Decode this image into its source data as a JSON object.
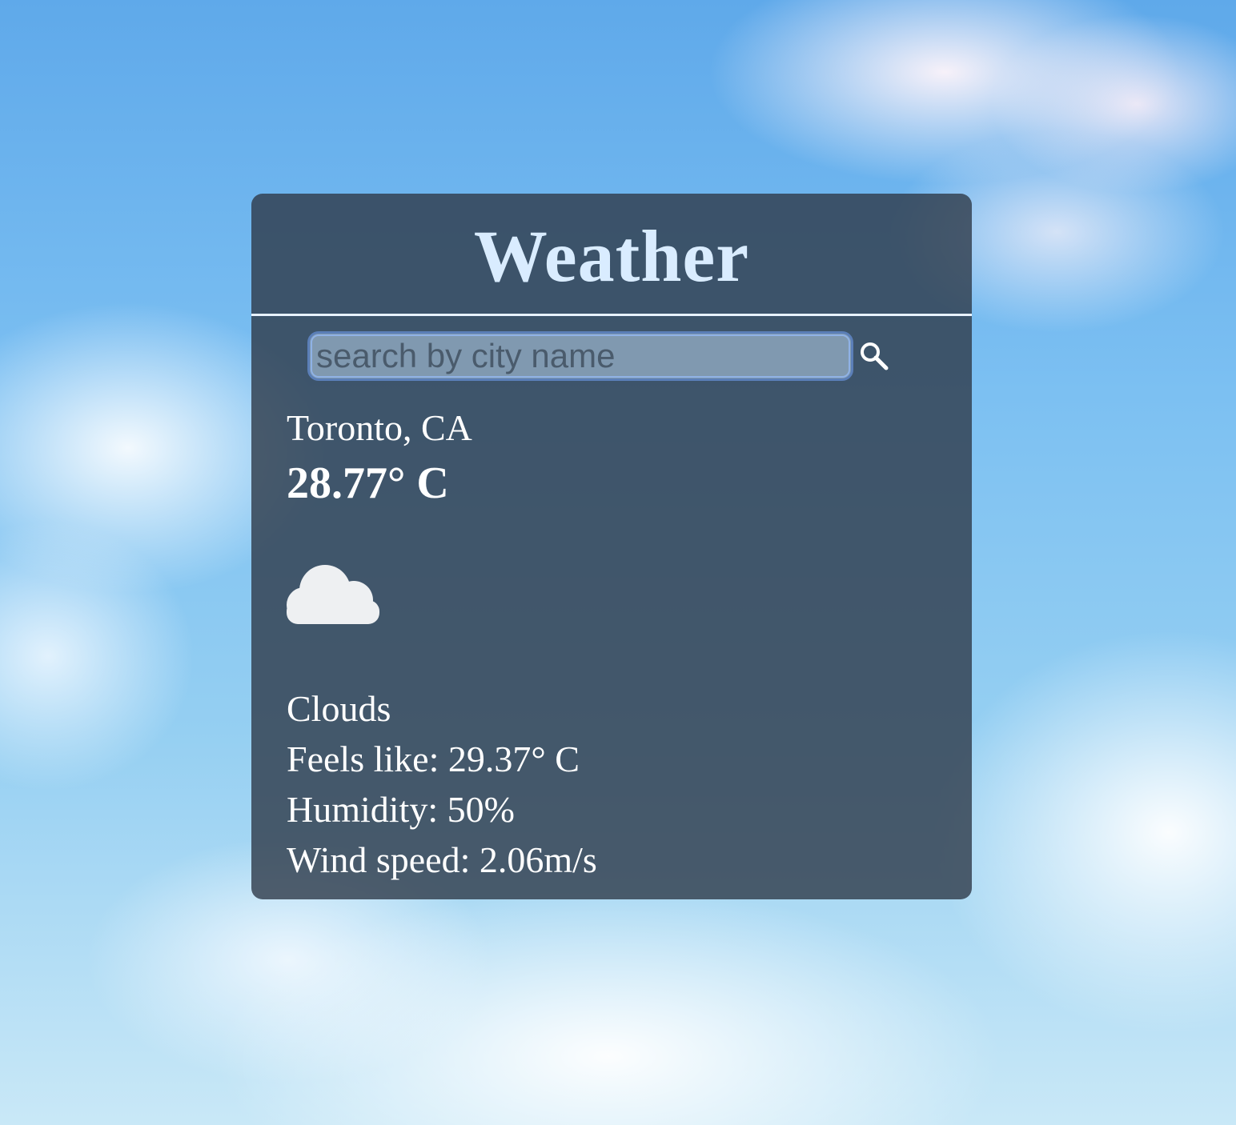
{
  "header": {
    "title": "Weather"
  },
  "search": {
    "placeholder": "search by city name",
    "value": "",
    "button_icon": "search-icon"
  },
  "current": {
    "location": "Toronto, CA",
    "temperature": "28.77° C",
    "icon": "cloud-icon",
    "description": "Clouds",
    "feels_like": "Feels like: 29.37° C",
    "humidity": "Humidity: 50%",
    "wind_speed": "Wind speed: 2.06m/s"
  },
  "colors": {
    "title": "#d9ecff",
    "card_background": "#2e3a48",
    "text": "#ffffff",
    "input_border": "#5b7fb8"
  }
}
